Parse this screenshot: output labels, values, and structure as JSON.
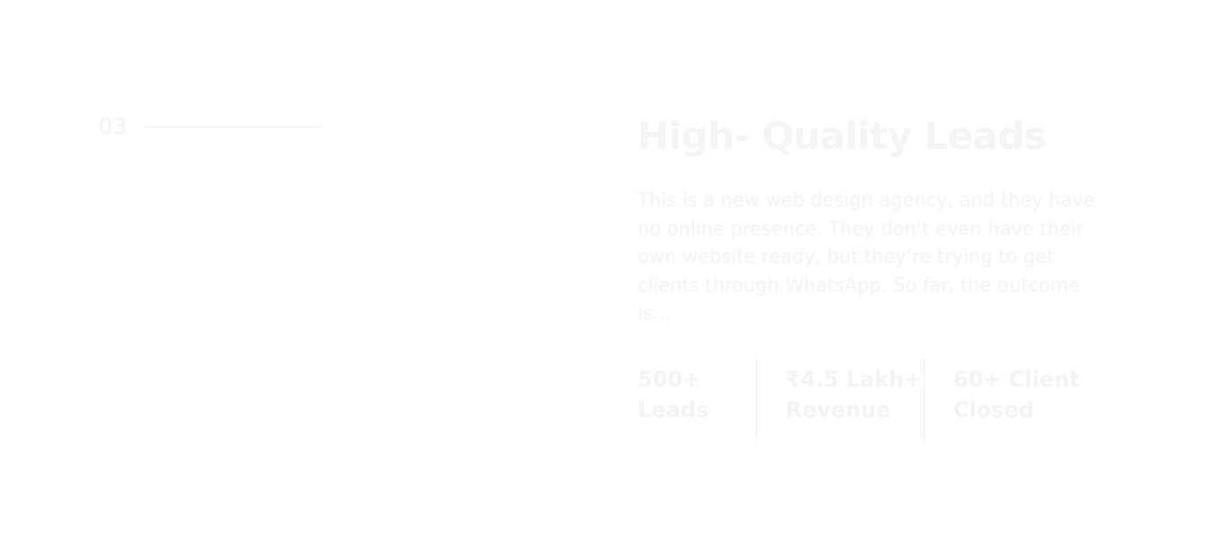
{
  "step": {
    "number": "03"
  },
  "feature": {
    "title": "High- Quality Leads",
    "description": "This is a new web design agency, and they have no online presence. They don’t even have their own website ready, but they’re trying to get clients through WhatsApp. So far, the outcome is..."
  },
  "stats": [
    {
      "line1": "500+",
      "line2": "Leads"
    },
    {
      "line1": "₹4.5 Lakh+",
      "line2": "Revenue"
    },
    {
      "line1": "60+ Client",
      "line2": "Closed"
    }
  ],
  "colors": {
    "background": "#ffffff",
    "text_faint": "#f3f3f3"
  }
}
